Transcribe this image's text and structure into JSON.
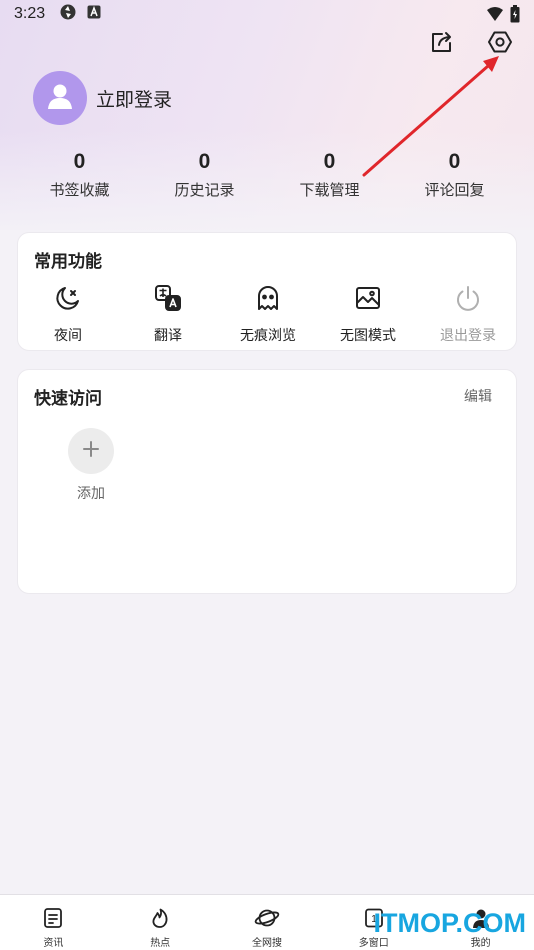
{
  "status_bar": {
    "time": "3:23"
  },
  "header": {
    "share_icon": "share-icon",
    "settings_icon": "settings-hexagon-icon"
  },
  "profile": {
    "login_label": "立即登录",
    "avatar_color": "#b197ec"
  },
  "stats": [
    {
      "value": "0",
      "label": "书签收藏"
    },
    {
      "value": "0",
      "label": "历史记录"
    },
    {
      "value": "0",
      "label": "下载管理"
    },
    {
      "value": "0",
      "label": "评论回复"
    }
  ],
  "common_functions": {
    "title": "常用功能",
    "items": [
      {
        "label": "夜间",
        "icon": "night-mode-icon"
      },
      {
        "label": "翻译",
        "icon": "translate-icon"
      },
      {
        "label": "无痕浏览",
        "icon": "ghost-icon"
      },
      {
        "label": "无图模式",
        "icon": "no-image-icon"
      },
      {
        "label": "退出登录",
        "icon": "power-icon",
        "disabled": true
      }
    ]
  },
  "quick_access": {
    "title": "快速访问",
    "edit_label": "编辑",
    "add_label": "添加"
  },
  "bottom_nav": [
    {
      "label": "资讯",
      "icon": "news-icon"
    },
    {
      "label": "热点",
      "icon": "flame-icon"
    },
    {
      "label": "全网搜",
      "icon": "planet-icon"
    },
    {
      "label": "多窗口",
      "icon": "windows-icon",
      "badge": "1"
    },
    {
      "label": "我的",
      "icon": "person-icon"
    }
  ],
  "watermark": "ITMOP.COM",
  "colors": {
    "accent_avatar": "#b197ec",
    "arrow": "#e0262b",
    "watermark": "#18a6e0"
  }
}
